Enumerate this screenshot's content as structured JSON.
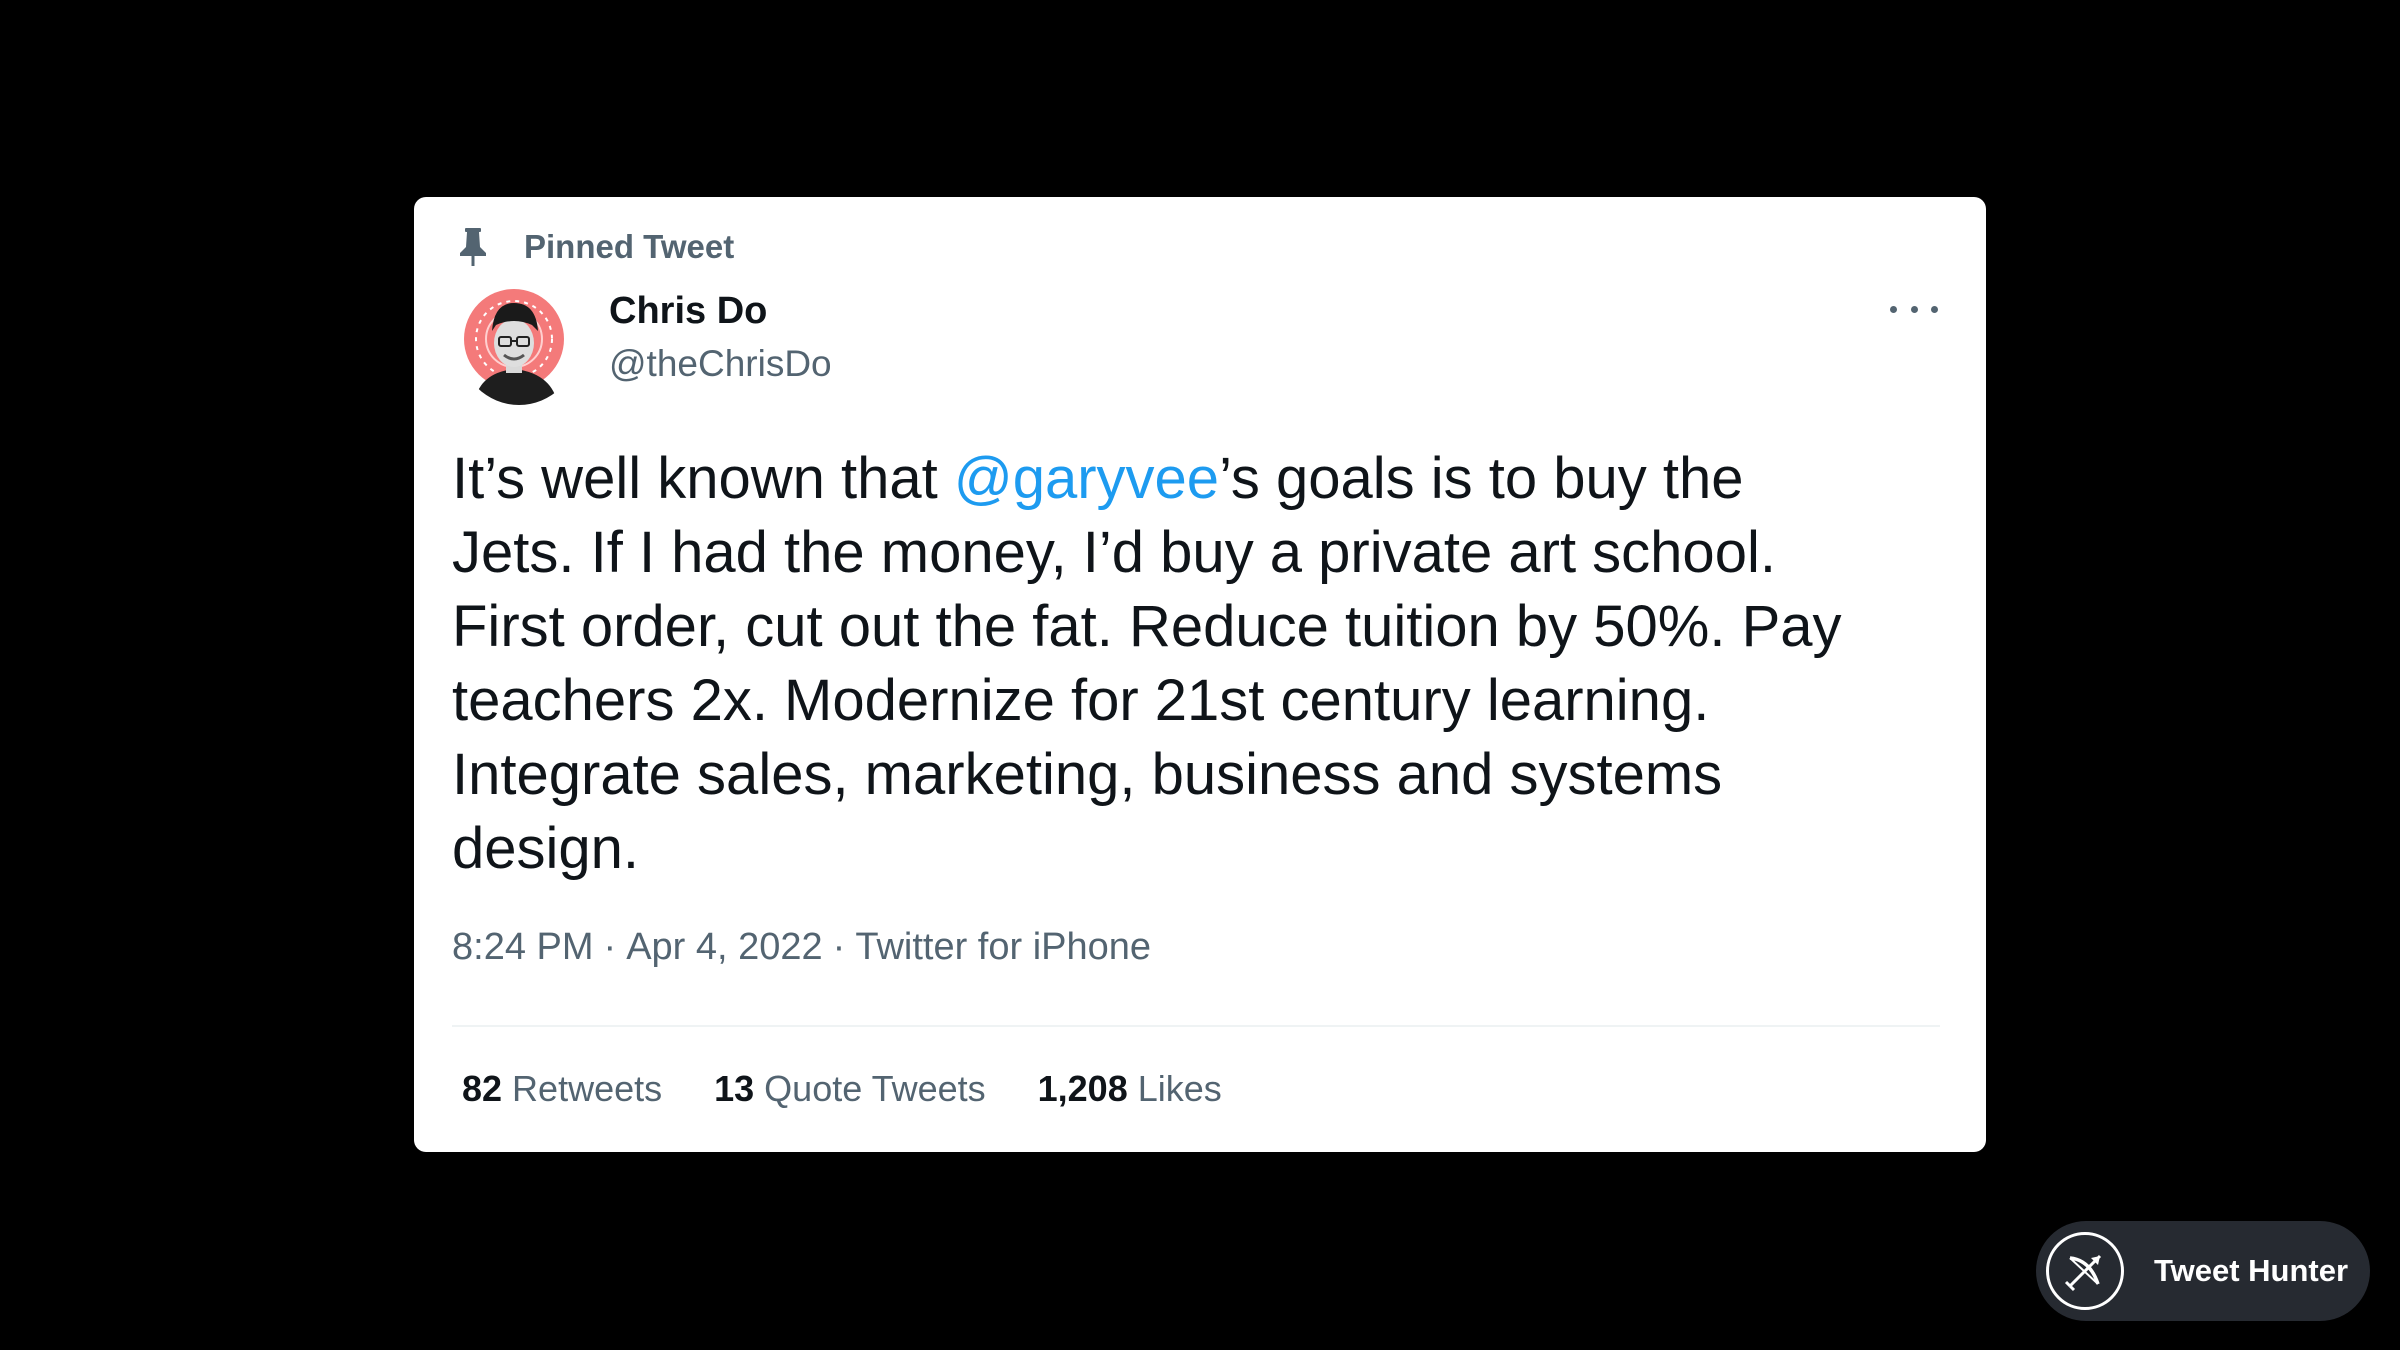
{
  "tweet": {
    "pinned_label": "Pinned Tweet",
    "author": {
      "display_name": "Chris Do",
      "handle": "@theChrisDo"
    },
    "text_lines": [
      [
        "It’s well known that ",
        "@garyvee",
        "’s goals is to buy the"
      ],
      "Jets. If I had the money, I’d buy a private art school.",
      "First order, cut out the fat. Reduce tuition by 50%. Pay",
      "teachers 2x. Modernize for 21st century learning.",
      "Integrate sales, marketing, business and systems",
      "design."
    ],
    "line1_prefix": "It’s well known that ",
    "mention": "@garyvee",
    "line1_suffix": "’s goals is to buy the",
    "line2": "Jets. If I had the money, I’d buy a private art school.",
    "line3": "First order, cut out the fat. Reduce tuition by 50%. Pay",
    "line4": "teachers 2x. Modernize for 21st century learning.",
    "line5": "Integrate sales, marketing, business and systems",
    "line6": "design.",
    "time": "8:24 PM",
    "date": "Apr 4, 2022",
    "separator": "·",
    "source": "Twitter for iPhone",
    "stats": {
      "retweets_count": "82",
      "retweets_label": "Retweets",
      "quotes_count": "13",
      "quotes_label": "Quote Tweets",
      "likes_count": "1,208",
      "likes_label": "Likes"
    }
  },
  "badge": {
    "label": "Tweet Hunter"
  },
  "colors": {
    "background": "#000000",
    "card": "#ffffff",
    "text_primary": "#0f1419",
    "text_secondary": "#536471",
    "link": "#1d9bf0",
    "badge_bg": "#262a31"
  },
  "icons": {
    "pin": "pin-icon",
    "more": "more-horizontal-icon",
    "badge": "bow-arrow-icon"
  }
}
